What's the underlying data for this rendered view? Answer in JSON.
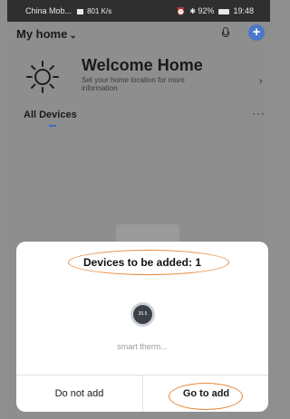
{
  "status_bar": {
    "carrier": "China Mob...",
    "net_speed": "801 K/s",
    "battery": "92%",
    "time": "19:48"
  },
  "header": {
    "home_title": "My  home",
    "chevron_icon": "chevron-down-icon",
    "mic_icon": "mic-icon",
    "add_icon": "plus-icon",
    "accent_color": "#4a77c9"
  },
  "welcome": {
    "title": "Welcome Home",
    "subtitle": "Set your home location for more information",
    "icon": "sun-icon",
    "arrow": "›"
  },
  "devices_tab": {
    "label": "All Devices",
    "more": "···"
  },
  "dialog": {
    "title": "Devices to be added: 1",
    "device": {
      "name": "smart therm...",
      "reading": "20.5"
    },
    "cancel_label": "Do not add",
    "confirm_label": "Go to add",
    "highlight_color": "#e8893b"
  }
}
